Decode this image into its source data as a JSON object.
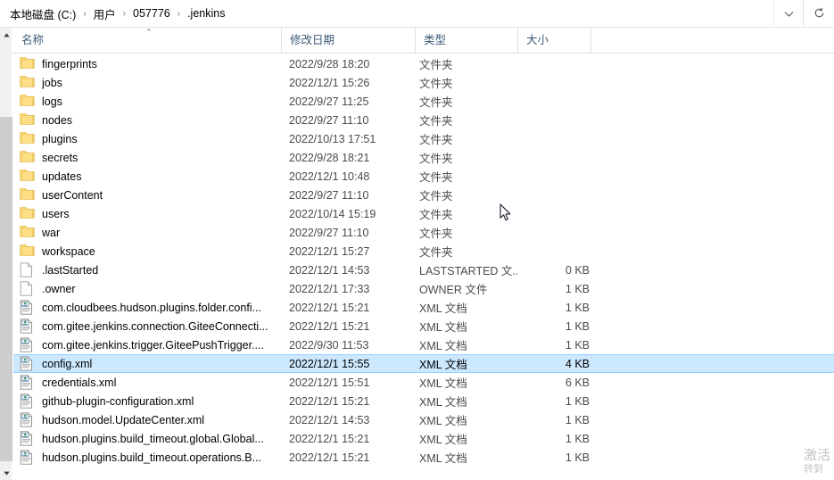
{
  "window": {
    "addressbar": {
      "crumbs": [
        "本地磁盘 (C:)",
        "用户",
        "057776",
        ".jenkins"
      ],
      "separator": "›",
      "dropdown_icon": "chevron-down-icon",
      "refresh_icon": "refresh-icon"
    }
  },
  "columns": [
    {
      "key": "name",
      "label": "名称",
      "sorted": "asc",
      "sort_caret": "⌃"
    },
    {
      "key": "date",
      "label": "修改日期"
    },
    {
      "key": "type",
      "label": "类型"
    },
    {
      "key": "size",
      "label": "大小"
    }
  ],
  "colors": {
    "selection_fill": "#cce8ff",
    "selection_border": "#99d1ff",
    "header_text": "#3c5a78",
    "folder_icon": "#ffd966",
    "secondary_text": "#4a4a4a"
  },
  "rows": [
    {
      "icon": "folder-icon",
      "name": "fingerprints",
      "date": "2022/9/28 18:20",
      "type": "文件夹",
      "size": "",
      "selected": false
    },
    {
      "icon": "folder-icon",
      "name": "jobs",
      "date": "2022/12/1 15:26",
      "type": "文件夹",
      "size": "",
      "selected": false
    },
    {
      "icon": "folder-icon",
      "name": "logs",
      "date": "2022/9/27 11:25",
      "type": "文件夹",
      "size": "",
      "selected": false
    },
    {
      "icon": "folder-icon",
      "name": "nodes",
      "date": "2022/9/27 11:10",
      "type": "文件夹",
      "size": "",
      "selected": false
    },
    {
      "icon": "folder-icon",
      "name": "plugins",
      "date": "2022/10/13 17:51",
      "type": "文件夹",
      "size": "",
      "selected": false
    },
    {
      "icon": "folder-icon",
      "name": "secrets",
      "date": "2022/9/28 18:21",
      "type": "文件夹",
      "size": "",
      "selected": false
    },
    {
      "icon": "folder-icon",
      "name": "updates",
      "date": "2022/12/1 10:48",
      "type": "文件夹",
      "size": "",
      "selected": false
    },
    {
      "icon": "folder-icon",
      "name": "userContent",
      "date": "2022/9/27 11:10",
      "type": "文件夹",
      "size": "",
      "selected": false
    },
    {
      "icon": "folder-icon",
      "name": "users",
      "date": "2022/10/14 15:19",
      "type": "文件夹",
      "size": "",
      "selected": false
    },
    {
      "icon": "folder-icon",
      "name": "war",
      "date": "2022/9/27 11:10",
      "type": "文件夹",
      "size": "",
      "selected": false
    },
    {
      "icon": "folder-icon",
      "name": "workspace",
      "date": "2022/12/1 15:27",
      "type": "文件夹",
      "size": "",
      "selected": false
    },
    {
      "icon": "blank-file-icon",
      "name": ".lastStarted",
      "date": "2022/12/1 14:53",
      "type": "LASTSTARTED 文...",
      "size": "0 KB",
      "selected": false
    },
    {
      "icon": "blank-file-icon",
      "name": ".owner",
      "date": "2022/12/1 17:33",
      "type": "OWNER 文件",
      "size": "1 KB",
      "selected": false
    },
    {
      "icon": "xml-file-icon",
      "name": "com.cloudbees.hudson.plugins.folder.confi...",
      "date": "2022/12/1 15:21",
      "type": "XML 文档",
      "size": "1 KB",
      "selected": false
    },
    {
      "icon": "xml-file-icon",
      "name": "com.gitee.jenkins.connection.GiteeConnecti...",
      "date": "2022/12/1 15:21",
      "type": "XML 文档",
      "size": "1 KB",
      "selected": false
    },
    {
      "icon": "xml-file-icon",
      "name": "com.gitee.jenkins.trigger.GiteePushTrigger....",
      "date": "2022/9/30 11:53",
      "type": "XML 文档",
      "size": "1 KB",
      "selected": false
    },
    {
      "icon": "xml-file-icon",
      "name": "config.xml",
      "date": "2022/12/1 15:55",
      "type": "XML 文档",
      "size": "4 KB",
      "selected": true
    },
    {
      "icon": "xml-file-icon",
      "name": "credentials.xml",
      "date": "2022/12/1 15:51",
      "type": "XML 文档",
      "size": "6 KB",
      "selected": false
    },
    {
      "icon": "xml-file-icon",
      "name": "github-plugin-configuration.xml",
      "date": "2022/12/1 15:21",
      "type": "XML 文档",
      "size": "1 KB",
      "selected": false
    },
    {
      "icon": "xml-file-icon",
      "name": "hudson.model.UpdateCenter.xml",
      "date": "2022/12/1 14:53",
      "type": "XML 文档",
      "size": "1 KB",
      "selected": false
    },
    {
      "icon": "xml-file-icon",
      "name": "hudson.plugins.build_timeout.global.Global...",
      "date": "2022/12/1 15:21",
      "type": "XML 文档",
      "size": "1 KB",
      "selected": false
    },
    {
      "icon": "xml-file-icon",
      "name": "hudson.plugins.build_timeout.operations.B...",
      "date": "2022/12/1 15:21",
      "type": "XML 文档",
      "size": "1 KB",
      "selected": false
    }
  ],
  "watermark": {
    "line1": "激活",
    "line2": "转到"
  },
  "scrollbar": {
    "up_arrow": "▲",
    "down_arrow": "▼"
  }
}
